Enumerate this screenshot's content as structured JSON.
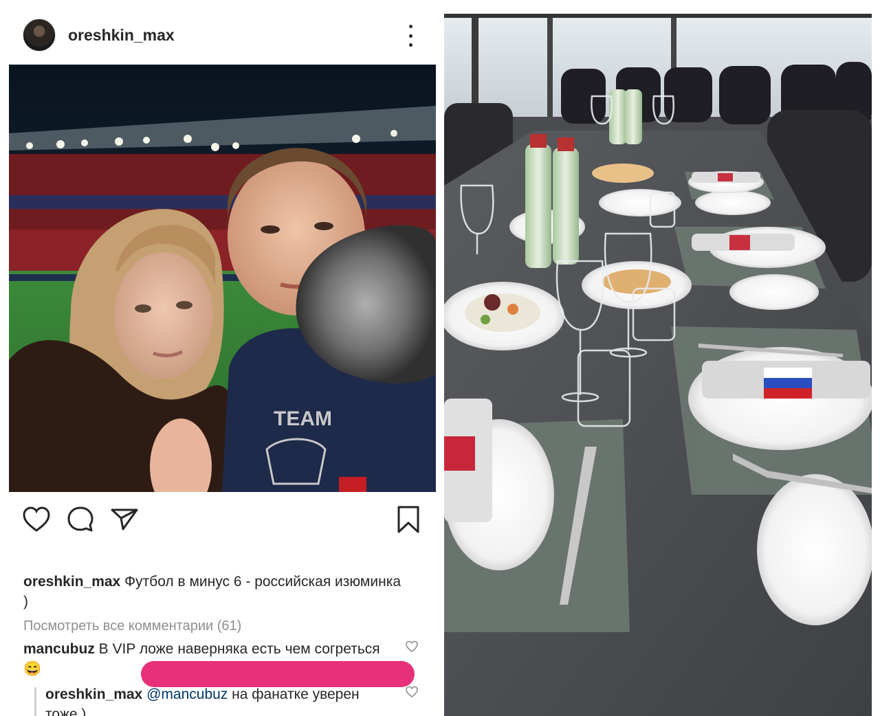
{
  "post": {
    "username": "oreshkin_max",
    "caption": {
      "author": "oreshkin_max",
      "text": " Футбол в минус 6 - российская изюминка )"
    },
    "view_all_comments": "Посмотреть все комментарии (61)",
    "comments": [
      {
        "author": "mancubuz",
        "text": " В VIP ложе наверняка есть чем согреться😄"
      }
    ],
    "reply": {
      "author": "oreshkin_max",
      "mention": "@mancubuz",
      "text": " на фанатке уверен тоже )"
    },
    "photo_text": "TEAM"
  },
  "icons": {
    "like": "heart-icon",
    "comment": "comment-icon",
    "share": "paper-plane-icon",
    "save": "bookmark-icon",
    "more": "more-vertical-icon"
  },
  "colors": {
    "redaction": "#e8307a",
    "mention": "#003569",
    "muted": "#8e8e8e"
  }
}
